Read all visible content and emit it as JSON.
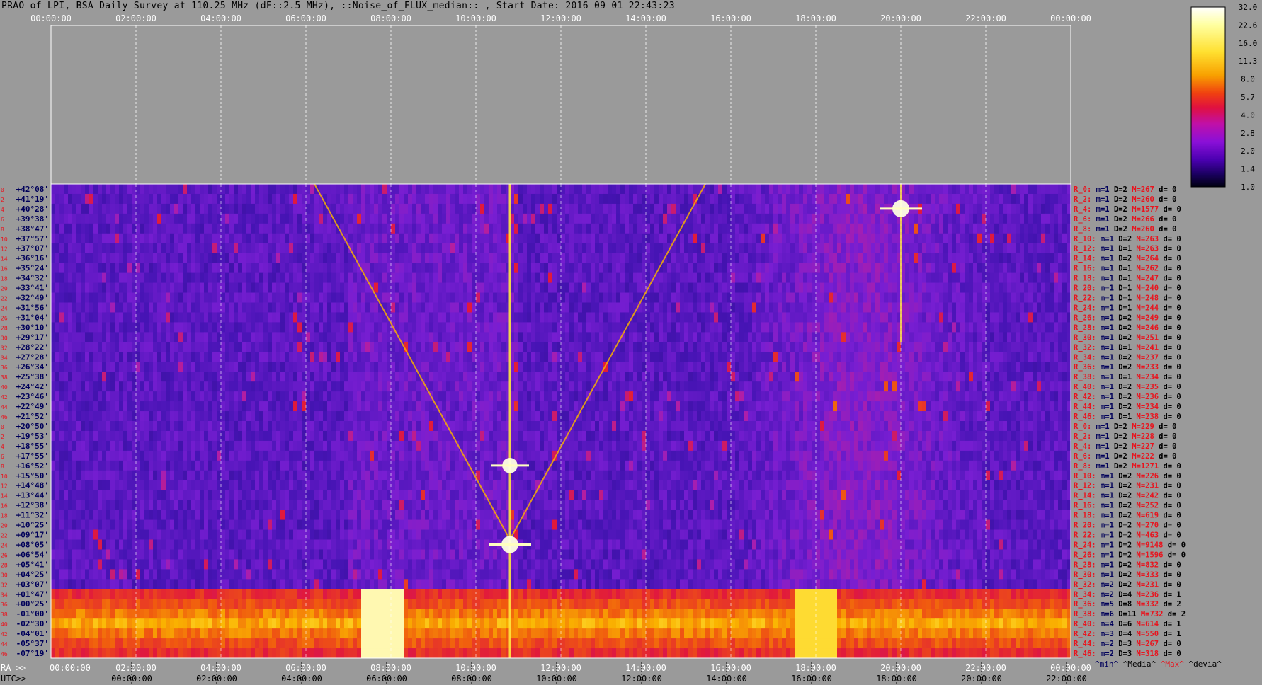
{
  "title": "PRAO of LPI, BSA Daily Survey at 110.25 MHz (dF::2.5 MHz), ::Noise_of_FLUX_median:: , Start Date: 2016 09 01 22:43:23",
  "colors": {
    "background": "#9a9a9a",
    "grid": "#ffffff",
    "label_red": "#e8141e",
    "label_navy": "#00005a",
    "label_black": "#000000"
  },
  "chart_data": {
    "type": "heatmap",
    "title": "PRAO of LPI, BSA Daily Survey at 110.25 MHz (dF::2.5 MHz), ::Noise_of_FLUX_median:: , Start Date: 2016 09 01 22:43:23",
    "top_axis_ticks": [
      "00:00:00",
      "02:00:00",
      "04:00:00",
      "06:00:00",
      "08:00:00",
      "10:00:00",
      "12:00:00",
      "14:00:00",
      "16:00:00",
      "18:00:00",
      "20:00:00",
      "22:00:00",
      "00:00:00"
    ],
    "ra_axis_label": "RA >>",
    "ra_axis_ticks": [
      "00:00:00",
      "02:00:00",
      "04:00:00",
      "06:00:00",
      "08:00:00",
      "10:00:00",
      "12:00:00",
      "14:00:00",
      "16:00:00",
      "18:00:00",
      "20:00:00",
      "22:00:00",
      "00:00:00"
    ],
    "utc_axis_label": "UTC>>",
    "utc_axis_ticks": [
      "00:00:00",
      "02:00:00",
      "04:00:00",
      "06:00:00",
      "08:00:00",
      "10:00:00",
      "12:00:00",
      "14:00:00",
      "16:00:00",
      "18:00:00",
      "20:00:00",
      "22:00:00"
    ],
    "x_range_hours": [
      0,
      24
    ],
    "utc_offset_hours": -1.9,
    "dec_labels": [
      "+42°08'",
      "+41°19'",
      "+40°28'",
      "+39°38'",
      "+38°47'",
      "+37°57'",
      "+37°07'",
      "+36°16'",
      "+35°24'",
      "+34°32'",
      "+33°41'",
      "+32°49'",
      "+31°56'",
      "+31°04'",
      "+30°10'",
      "+29°17'",
      "+28°22'",
      "+27°28'",
      "+26°34'",
      "+25°38'",
      "+24°42'",
      "+23°46'",
      "+22°49'",
      "+21°52'",
      "+20°50'",
      "+19°53'",
      "+18°55'",
      "+17°55'",
      "+16°52'",
      "+15°50'",
      "+14°48'",
      "+13°44'",
      "+12°38'",
      "+11°32'",
      "+10°25'",
      "+09°17'",
      "+08°05'",
      "+06°54'",
      "+05°41'",
      "+04°25'",
      "+03°07'",
      "+01°47'",
      "+00°25'",
      "-01°00'",
      "-02°30'",
      "-04°01'",
      "-05°37'",
      "-07°19'"
    ],
    "row_index_labels": [
      "0",
      "2",
      "4",
      "6",
      "8",
      "10",
      "12",
      "14",
      "16",
      "18",
      "20",
      "22",
      "24",
      "26",
      "28",
      "30",
      "32",
      "34",
      "36",
      "38",
      "40",
      "42",
      "44",
      "46",
      "0",
      "2",
      "4",
      "6",
      "8",
      "10",
      "12",
      "14",
      "16",
      "18",
      "20",
      "22",
      "24",
      "26",
      "28",
      "30",
      "32",
      "34",
      "36",
      "38",
      "40",
      "42",
      "44",
      "46"
    ],
    "row_stats": [
      {
        "r": "R_0:",
        "min": "m=1",
        "d": "D=2",
        "max": "M=267",
        "dev": "d= 0"
      },
      {
        "r": "R_2:",
        "min": "m=1",
        "d": "D=2",
        "max": "M=260",
        "dev": "d= 0"
      },
      {
        "r": "R_4:",
        "min": "m=1",
        "d": "D=2",
        "max": "M=1577",
        "dev": "d= 0"
      },
      {
        "r": "R_6:",
        "min": "m=1",
        "d": "D=2",
        "max": "M=266",
        "dev": "d= 0"
      },
      {
        "r": "R_8:",
        "min": "m=1",
        "d": "D=2",
        "max": "M=260",
        "dev": "d= 0"
      },
      {
        "r": "R_10:",
        "min": "m=1",
        "d": "D=2",
        "max": "M=263",
        "dev": "d= 0"
      },
      {
        "r": "R_12:",
        "min": "m=1",
        "d": "D=1",
        "max": "M=263",
        "dev": "d= 0"
      },
      {
        "r": "R_14:",
        "min": "m=1",
        "d": "D=2",
        "max": "M=264",
        "dev": "d= 0"
      },
      {
        "r": "R_16:",
        "min": "m=1",
        "d": "D=1",
        "max": "M=262",
        "dev": "d= 0"
      },
      {
        "r": "R_18:",
        "min": "m=1",
        "d": "D=1",
        "max": "M=247",
        "dev": "d= 0"
      },
      {
        "r": "R_20:",
        "min": "m=1",
        "d": "D=1",
        "max": "M=240",
        "dev": "d= 0"
      },
      {
        "r": "R_22:",
        "min": "m=1",
        "d": "D=1",
        "max": "M=248",
        "dev": "d= 0"
      },
      {
        "r": "R_24:",
        "min": "m=1",
        "d": "D=1",
        "max": "M=244",
        "dev": "d= 0"
      },
      {
        "r": "R_26:",
        "min": "m=1",
        "d": "D=2",
        "max": "M=249",
        "dev": "d= 0"
      },
      {
        "r": "R_28:",
        "min": "m=1",
        "d": "D=2",
        "max": "M=246",
        "dev": "d= 0"
      },
      {
        "r": "R_30:",
        "min": "m=1",
        "d": "D=2",
        "max": "M=251",
        "dev": "d= 0"
      },
      {
        "r": "R_32:",
        "min": "m=1",
        "d": "D=1",
        "max": "M=241",
        "dev": "d= 0"
      },
      {
        "r": "R_34:",
        "min": "m=1",
        "d": "D=2",
        "max": "M=237",
        "dev": "d= 0"
      },
      {
        "r": "R_36:",
        "min": "m=1",
        "d": "D=2",
        "max": "M=233",
        "dev": "d= 0"
      },
      {
        "r": "R_38:",
        "min": "m=1",
        "d": "D=1",
        "max": "M=234",
        "dev": "d= 0"
      },
      {
        "r": "R_40:",
        "min": "m=1",
        "d": "D=2",
        "max": "M=235",
        "dev": "d= 0"
      },
      {
        "r": "R_42:",
        "min": "m=1",
        "d": "D=2",
        "max": "M=236",
        "dev": "d= 0"
      },
      {
        "r": "R_44:",
        "min": "m=1",
        "d": "D=2",
        "max": "M=234",
        "dev": "d= 0"
      },
      {
        "r": "R_46:",
        "min": "m=1",
        "d": "D=1",
        "max": "M=238",
        "dev": "d= 0"
      },
      {
        "r": "R_0:",
        "min": "m=1",
        "d": "D=2",
        "max": "M=229",
        "dev": "d= 0"
      },
      {
        "r": "R_2:",
        "min": "m=1",
        "d": "D=2",
        "max": "M=228",
        "dev": "d= 0"
      },
      {
        "r": "R_4:",
        "min": "m=1",
        "d": "D=2",
        "max": "M=227",
        "dev": "d= 0"
      },
      {
        "r": "R_6:",
        "min": "m=1",
        "d": "D=2",
        "max": "M=222",
        "dev": "d= 0"
      },
      {
        "r": "R_8:",
        "min": "m=1",
        "d": "D=2",
        "max": "M=1271",
        "dev": "d= 0"
      },
      {
        "r": "R_10:",
        "min": "m=1",
        "d": "D=2",
        "max": "M=226",
        "dev": "d= 0"
      },
      {
        "r": "R_12:",
        "min": "m=1",
        "d": "D=2",
        "max": "M=231",
        "dev": "d= 0"
      },
      {
        "r": "R_14:",
        "min": "m=1",
        "d": "D=2",
        "max": "M=242",
        "dev": "d= 0"
      },
      {
        "r": "R_16:",
        "min": "m=1",
        "d": "D=2",
        "max": "M=252",
        "dev": "d= 0"
      },
      {
        "r": "R_18:",
        "min": "m=1",
        "d": "D=2",
        "max": "M=619",
        "dev": "d= 0"
      },
      {
        "r": "R_20:",
        "min": "m=1",
        "d": "D=2",
        "max": "M=270",
        "dev": "d= 0"
      },
      {
        "r": "R_22:",
        "min": "m=1",
        "d": "D=2",
        "max": "M=463",
        "dev": "d= 0"
      },
      {
        "r": "R_24:",
        "min": "m=1",
        "d": "D=2",
        "max": "M=9148",
        "dev": "d= 0"
      },
      {
        "r": "R_26:",
        "min": "m=1",
        "d": "D=2",
        "max": "M=1596",
        "dev": "d= 0"
      },
      {
        "r": "R_28:",
        "min": "m=1",
        "d": "D=2",
        "max": "M=832",
        "dev": "d= 0"
      },
      {
        "r": "R_30:",
        "min": "m=1",
        "d": "D=2",
        "max": "M=333",
        "dev": "d= 0"
      },
      {
        "r": "R_32:",
        "min": "m=2",
        "d": "D=2",
        "max": "M=231",
        "dev": "d= 0"
      },
      {
        "r": "R_34:",
        "min": "m=2",
        "d": "D=4",
        "max": "M=236",
        "dev": "d= 1"
      },
      {
        "r": "R_36:",
        "min": "m=5",
        "d": "D=8",
        "max": "M=332",
        "dev": "d= 2"
      },
      {
        "r": "R_38:",
        "min": "m=6",
        "d": "D=11",
        "max": "M=732",
        "dev": "d= 2"
      },
      {
        "r": "R_40:",
        "min": "m=4",
        "d": "D=6",
        "max": "M=614",
        "dev": "d= 1"
      },
      {
        "r": "R_42:",
        "min": "m=3",
        "d": "D=4",
        "max": "M=550",
        "dev": "d= 1"
      },
      {
        "r": "R_44:",
        "min": "m=2",
        "d": "D=3",
        "max": "M=267",
        "dev": "d= 0"
      },
      {
        "r": "R_46:",
        "min": "m=2",
        "d": "D=3",
        "max": "M=318",
        "dev": "d= 0"
      }
    ],
    "stats_footer": [
      "^min^",
      "^Media^",
      "^Max^",
      "^devia^"
    ],
    "colorbar": {
      "ticks": [
        "32.0",
        "22.6",
        "16.0",
        "11.3",
        "8.0",
        "5.7",
        "4.0",
        "2.8",
        "2.0",
        "1.4",
        "1.0"
      ],
      "colors": [
        "#000010",
        "#1a0060",
        "#4a00b0",
        "#8a20c8",
        "#c020a0",
        "#e02030",
        "#f06010",
        "#f8b000",
        "#ffe840",
        "#ffffc0",
        "#ffffff"
      ]
    },
    "features": {
      "horizontal_band_dec_row_range": [
        41,
        47
      ],
      "bright_spots": [
        {
          "ra_hours": 10.8,
          "row": 36,
          "level": 1.0
        },
        {
          "ra_hours": 10.8,
          "row": 28,
          "level": 0.9
        },
        {
          "ra_hours": 20.0,
          "row": 2,
          "level": 1.0
        }
      ]
    }
  }
}
